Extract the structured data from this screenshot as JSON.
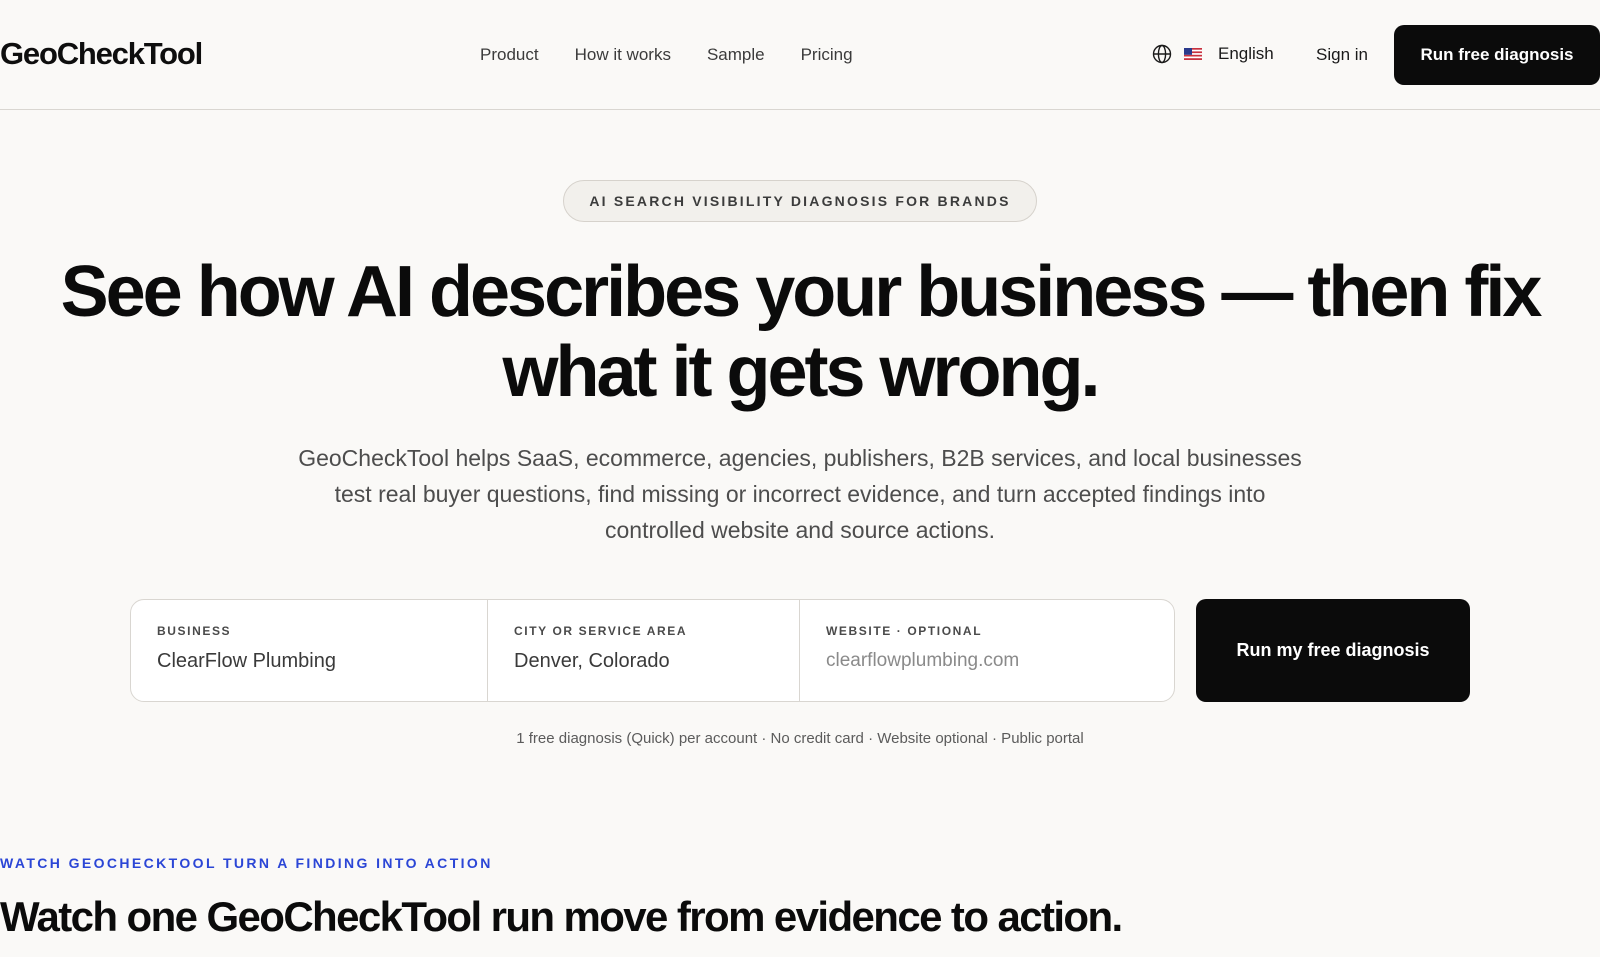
{
  "header": {
    "logo": "GeoCheckTool",
    "nav": [
      "Product",
      "How it works",
      "Sample",
      "Pricing"
    ],
    "language": "English",
    "signin": "Sign in",
    "cta": "Run free diagnosis"
  },
  "hero": {
    "eyebrow": "AI SEARCH VISIBILITY DIAGNOSIS FOR BRANDS",
    "headline": "See how AI describes your business — then fix what it gets wrong.",
    "subhead": "GeoCheckTool helps SaaS, ecommerce, agencies, publishers, B2B services, and local businesses test real buyer questions, find missing or incorrect evidence, and turn accepted findings into controlled website and source actions."
  },
  "form": {
    "business_label": "BUSINESS",
    "business_value": "ClearFlow Plumbing",
    "city_label": "CITY OR SERVICE AREA",
    "city_value": "Denver, Colorado",
    "website_label": "WEBSITE · OPTIONAL",
    "website_placeholder": "clearflowplumbing.com",
    "submit": "Run my free diagnosis",
    "fineprint": "1 free diagnosis (Quick) per account · No credit card · Website optional · Public portal"
  },
  "section": {
    "eyebrow": "WATCH GEOCHECKTOOL TURN A FINDING INTO ACTION",
    "title": "Watch one GeoCheckTool run move from evidence to action."
  },
  "icons": {
    "language": "globe-icon",
    "flag": "us-flag-icon"
  },
  "colors": {
    "background": "#faf9f7",
    "primary_button": "#0b0b0b",
    "accent_eyebrow": "#2b46d6"
  }
}
